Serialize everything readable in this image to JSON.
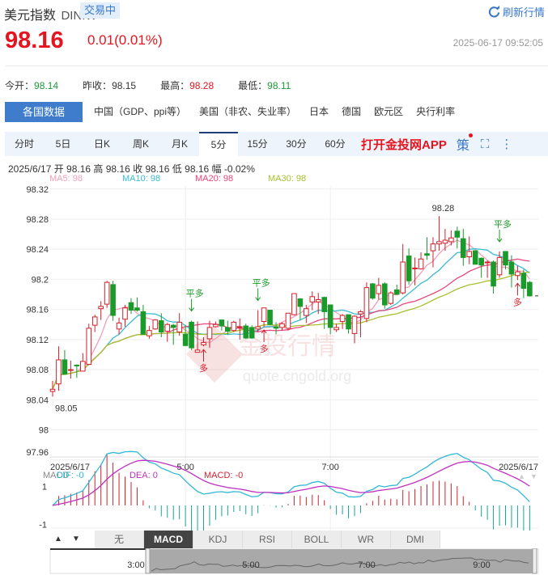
{
  "header": {
    "name": "美元指数",
    "code": "DINIW",
    "status": "交易中",
    "refresh_label": "刷新行情",
    "refresh_icon": "refresh-icon"
  },
  "quote": {
    "price": "98.16",
    "change": "0.01(0.01%)",
    "time": "2025-06-17 09:52:05"
  },
  "stats": [
    {
      "label": "今开：",
      "value": "98.14",
      "color": "green"
    },
    {
      "label": "昨收：",
      "value": "98.15",
      "color": "neutral"
    },
    {
      "label": "最高：",
      "value": "98.28",
      "color": "red"
    },
    {
      "label": "最低：",
      "value": "98.11",
      "color": "green"
    }
  ],
  "country_tabs": [
    "各国数据",
    "中国（GDP、ppi等）",
    "美国（非农、失业率）",
    "日本",
    "德国",
    "欧元区",
    "央行利率"
  ],
  "period_tabs": [
    "分时",
    "5日",
    "日K",
    "周K",
    "月K",
    "5分",
    "15分",
    "30分",
    "60分"
  ],
  "active_period": "5分",
  "app_link": "打开金投网APP",
  "strategy_label": "策",
  "info_line": "2025/6/17  开 98.16  高 98.16  收 98.16  低 98.16  幅 -0.02%",
  "ma_legend": [
    {
      "label": "MA5: 98",
      "color": "#f0a0b8"
    },
    {
      "label": "MA10: 98",
      "color": "#3bbbd0"
    },
    {
      "label": "MA20: 98",
      "color": "#e8467c"
    },
    {
      "label": "MA30: 98",
      "color": "#a8c030"
    }
  ],
  "watermark": {
    "text": "金投行情",
    "url": "quote.cngold.org"
  },
  "colors": {
    "up": "#d4202a",
    "down": "#1a9a2a",
    "macd_neg": "#1aa39a",
    "dif": "#30b8d8",
    "dea": "#c030c0"
  },
  "chart_data": {
    "type": "candlestick",
    "y_ticks": [
      "98.32",
      "98.28",
      "98.24",
      "98.2",
      "98.16",
      "98.12",
      "98.08",
      "98.04",
      "98",
      "97.96"
    ],
    "ylim": [
      97.964,
      98.324
    ],
    "x_labels": [
      {
        "label": "2025/6/17",
        "index": 0
      },
      {
        "label": "5:00",
        "index": 22
      },
      {
        "label": "7:00",
        "index": 46
      },
      {
        "label": "2025/6/17",
        "index": 79
      }
    ],
    "ohlc": [
      [
        98.051,
        98.065,
        98.044,
        98.054
      ],
      [
        98.061,
        98.111,
        98.052,
        98.093
      ],
      [
        98.093,
        98.106,
        98.073,
        98.074
      ],
      [
        98.079,
        98.092,
        98.068,
        98.08
      ],
      [
        98.086,
        98.087,
        98.069,
        98.085
      ],
      [
        98.078,
        98.102,
        98.078,
        98.091
      ],
      [
        98.087,
        98.141,
        98.086,
        98.135
      ],
      [
        98.139,
        98.153,
        98.13,
        98.15
      ],
      [
        98.161,
        98.171,
        98.146,
        98.164
      ],
      [
        98.167,
        98.198,
        98.162,
        98.196
      ],
      [
        98.193,
        98.198,
        98.145,
        98.152
      ],
      [
        98.134,
        98.149,
        98.127,
        98.142
      ],
      [
        98.147,
        98.166,
        98.137,
        98.162
      ],
      [
        98.169,
        98.175,
        98.154,
        98.159
      ],
      [
        98.162,
        98.176,
        98.157,
        98.159
      ],
      [
        98.157,
        98.166,
        98.127,
        98.127
      ],
      [
        98.125,
        98.138,
        98.121,
        98.132
      ],
      [
        98.134,
        98.147,
        98.133,
        98.146
      ],
      [
        98.145,
        98.155,
        98.123,
        98.13
      ],
      [
        98.131,
        98.142,
        98.117,
        98.14
      ],
      [
        98.139,
        98.141,
        98.113,
        98.136
      ],
      [
        98.13,
        98.155,
        98.125,
        98.143
      ],
      [
        98.127,
        98.139,
        98.111,
        98.112
      ],
      [
        98.143,
        98.145,
        98.106,
        98.109
      ],
      [
        98.103,
        98.144,
        98.103,
        98.106
      ],
      [
        98.113,
        98.123,
        98.111,
        98.116
      ],
      [
        98.121,
        98.145,
        98.109,
        98.136
      ],
      [
        98.137,
        98.144,
        98.136,
        98.14
      ],
      [
        98.146,
        98.146,
        98.132,
        98.138
      ],
      [
        98.136,
        98.145,
        98.127,
        98.131
      ],
      [
        98.132,
        98.145,
        98.13,
        98.143
      ],
      [
        98.136,
        98.148,
        98.12,
        98.137
      ],
      [
        98.138,
        98.141,
        98.121,
        98.122
      ],
      [
        98.136,
        98.139,
        98.121,
        98.122
      ],
      [
        98.134,
        98.159,
        98.13,
        98.137
      ],
      [
        98.144,
        98.162,
        98.137,
        98.162
      ],
      [
        98.159,
        98.159,
        98.139,
        98.14
      ],
      [
        98.137,
        98.143,
        98.127,
        98.135
      ],
      [
        98.136,
        98.143,
        98.132,
        98.141
      ],
      [
        98.135,
        98.155,
        98.132,
        98.155
      ],
      [
        98.153,
        98.181,
        98.152,
        98.181
      ],
      [
        98.174,
        98.175,
        98.146,
        98.164
      ],
      [
        98.152,
        98.166,
        98.142,
        98.161
      ],
      [
        98.17,
        98.184,
        98.159,
        98.177
      ],
      [
        98.17,
        98.182,
        98.154,
        98.173
      ],
      [
        98.176,
        98.177,
        98.134,
        98.157
      ],
      [
        98.166,
        98.166,
        98.127,
        98.136
      ],
      [
        98.133,
        98.141,
        98.13,
        98.136
      ],
      [
        98.144,
        98.154,
        98.134,
        98.152
      ],
      [
        98.153,
        98.153,
        98.128,
        98.134
      ],
      [
        98.128,
        98.152,
        98.115,
        98.151
      ],
      [
        98.154,
        98.159,
        98.123,
        98.157
      ],
      [
        98.148,
        98.196,
        98.143,
        98.189
      ],
      [
        98.194,
        98.195,
        98.173,
        98.175
      ],
      [
        98.181,
        98.202,
        98.173,
        98.192
      ],
      [
        98.194,
        98.196,
        98.161,
        98.166
      ],
      [
        98.168,
        98.184,
        98.166,
        98.182
      ],
      [
        98.186,
        98.193,
        98.18,
        98.18
      ],
      [
        98.182,
        98.247,
        98.18,
        98.223
      ],
      [
        98.231,
        98.241,
        98.193,
        98.198
      ],
      [
        98.214,
        98.229,
        98.192,
        98.215
      ],
      [
        98.214,
        98.236,
        98.213,
        98.227
      ],
      [
        98.234,
        98.256,
        98.226,
        98.232
      ],
      [
        98.238,
        98.256,
        98.216,
        98.247
      ],
      [
        98.247,
        98.284,
        98.238,
        98.25
      ],
      [
        98.248,
        98.267,
        98.238,
        98.252
      ],
      [
        98.25,
        98.265,
        98.245,
        98.255
      ],
      [
        98.264,
        98.27,
        98.241,
        98.256
      ],
      [
        98.254,
        98.267,
        98.218,
        98.229
      ],
      [
        98.23,
        98.257,
        98.22,
        98.237
      ],
      [
        98.238,
        98.238,
        98.22,
        98.22
      ],
      [
        98.228,
        98.229,
        98.202,
        98.219
      ],
      [
        98.222,
        98.225,
        98.202,
        98.223
      ],
      [
        98.223,
        98.225,
        98.181,
        98.191
      ],
      [
        98.206,
        98.237,
        98.202,
        98.229
      ],
      [
        98.237,
        98.237,
        98.213,
        98.219
      ],
      [
        98.223,
        98.232,
        98.189,
        98.207
      ],
      [
        98.205,
        98.218,
        98.199,
        98.21
      ],
      [
        98.208,
        98.213,
        98.175,
        98.188
      ],
      [
        98.196,
        98.198,
        98.177,
        98.178
      ]
    ],
    "ma_periods": [
      5,
      10,
      20,
      30
    ],
    "annotations": [
      {
        "text": "98.05",
        "index": 0,
        "type": "low"
      },
      {
        "text": "98.28",
        "index": 64,
        "type": "high"
      }
    ],
    "signals": [
      {
        "text": "平多",
        "index": 23,
        "type": "close-long"
      },
      {
        "text": "多",
        "index": 25,
        "type": "long"
      },
      {
        "text": "平多",
        "index": 34,
        "type": "close-long"
      },
      {
        "text": "多",
        "index": 35,
        "type": "long"
      },
      {
        "text": "平多",
        "index": 74,
        "type": "close-long"
      },
      {
        "text": "多",
        "index": 77,
        "type": "long"
      }
    ],
    "macd": {
      "label": "MACD",
      "dif_label": "DIF: -0",
      "dea_label": "DEA: 0",
      "macd_label": "MACD: -0",
      "y_ticks": [
        "1",
        "-1"
      ]
    }
  },
  "indicator_tabs": [
    "无",
    "MACD",
    "KDJ",
    "RSI",
    "BOLL",
    "WR",
    "DMI"
  ],
  "active_indicator": "MACD",
  "navigator": {
    "labels": [
      "3:00",
      "5:00",
      "7:00",
      "9:00"
    ]
  }
}
